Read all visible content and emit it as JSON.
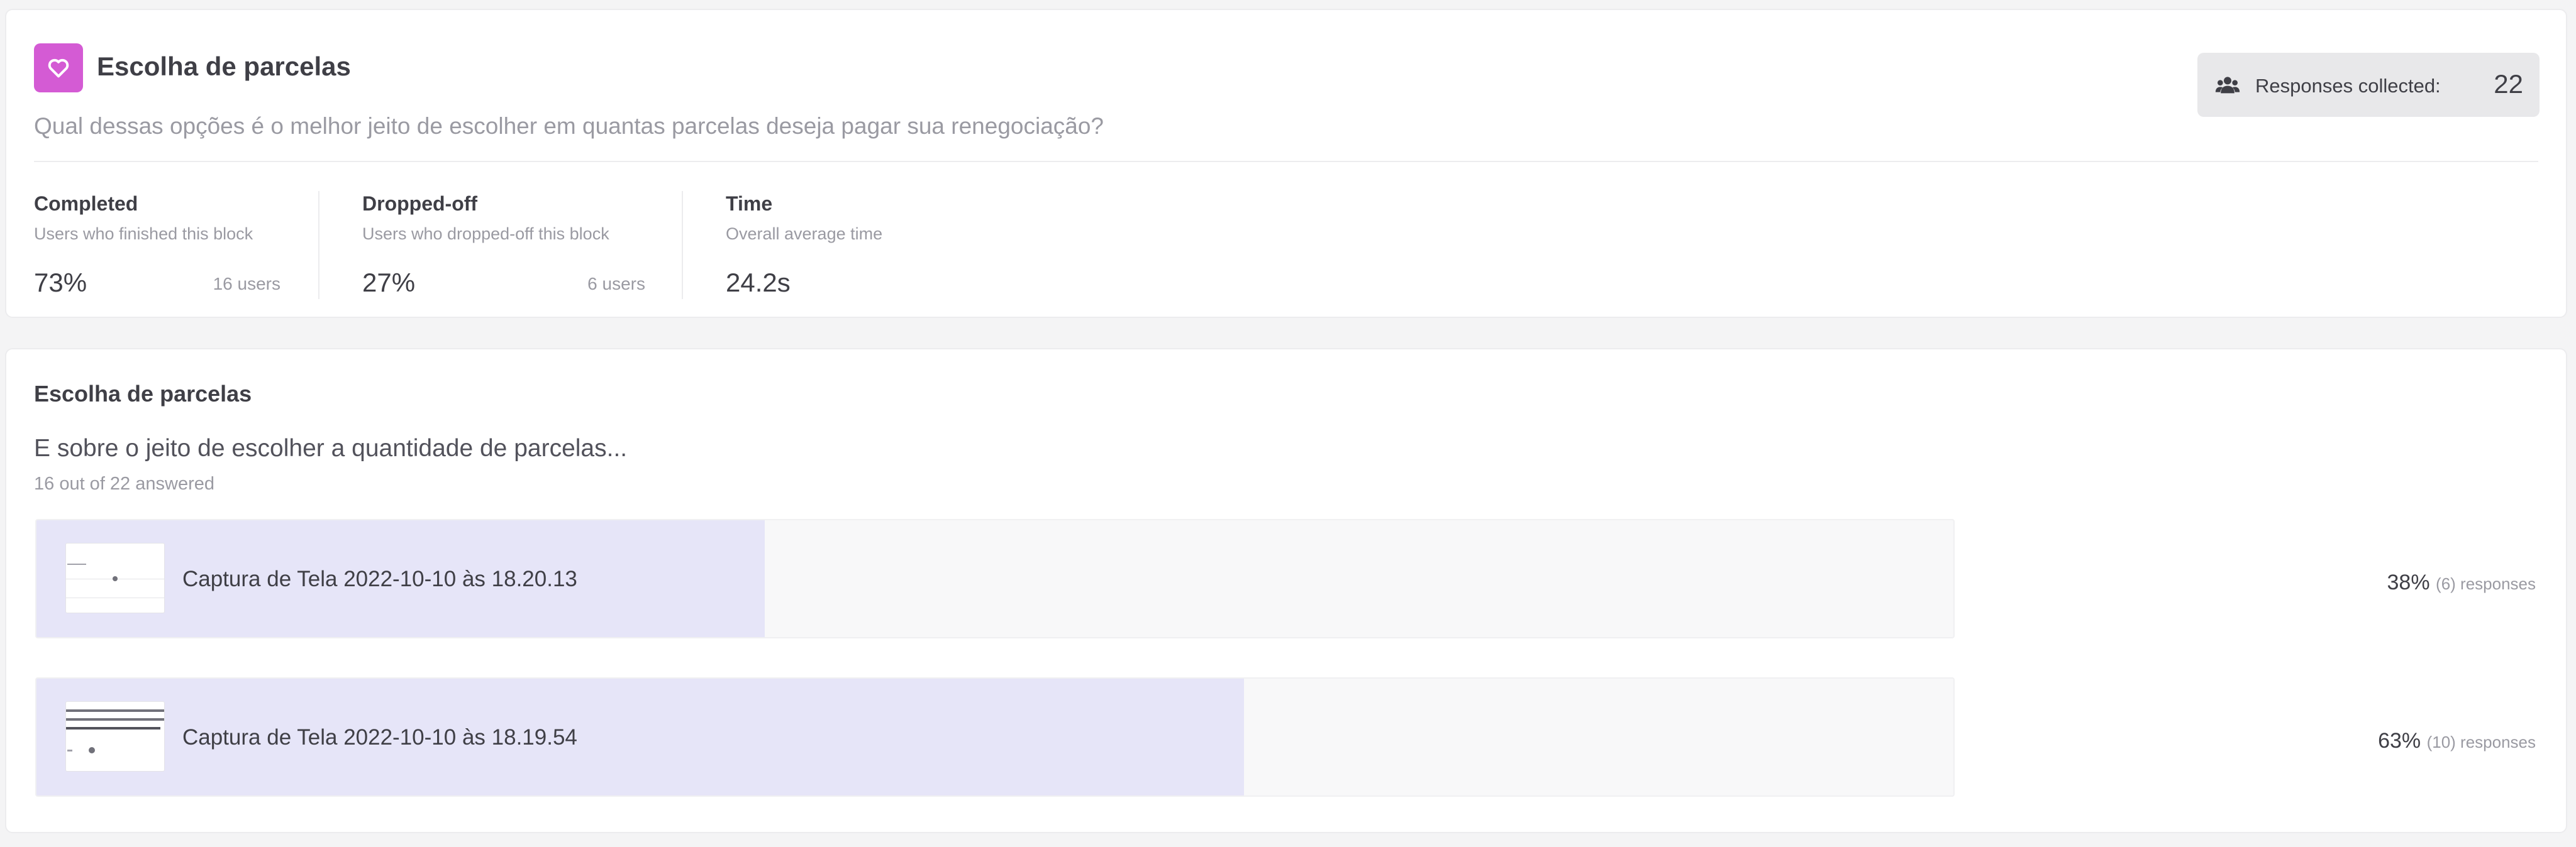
{
  "block": {
    "title": "Escolha de parcelas",
    "description": "Qual dessas opções é o melhor jeito de escolher em quantas parcelas deseja pagar sua renegociação?",
    "icon": "heart-icon",
    "accent_color": "#d45bd4"
  },
  "responses": {
    "label": "Responses collected:",
    "count": "22",
    "icon": "users-icon"
  },
  "stats": [
    {
      "title": "Completed",
      "subtitle": "Users who finished this block",
      "value": "73%",
      "users": "16 users"
    },
    {
      "title": "Dropped-off",
      "subtitle": "Users who dropped-off this block",
      "value": "27%",
      "users": "6 users"
    },
    {
      "title": "Time",
      "subtitle": "Overall average time",
      "value": "24.2s",
      "users": ""
    }
  ],
  "question": {
    "block_title": "Escolha de parcelas",
    "text": "E sobre o jeito de escolher a quantidade de parcelas...",
    "answered": "16 out of 22 answered",
    "bar_color": "#e6e5f8",
    "options": [
      {
        "label": "Captura de Tela 2022-10-10 às 18.20.13",
        "percent": "38%",
        "responses": "(6) responses",
        "fill": 0.38
      },
      {
        "label": "Captura de Tela 2022-10-10 às 18.19.54",
        "percent": "63%",
        "responses": "(10) responses",
        "fill": 0.63
      }
    ]
  }
}
